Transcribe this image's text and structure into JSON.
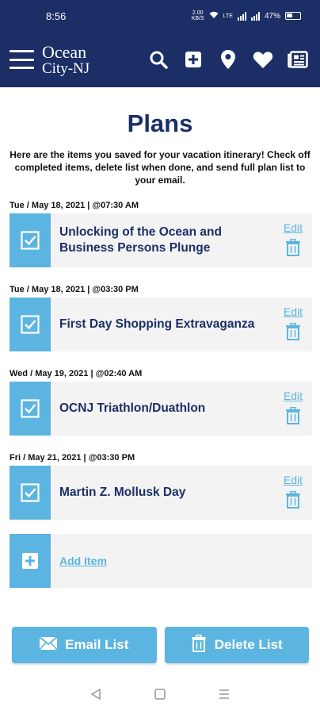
{
  "status_bar": {
    "time": "8:56",
    "network_speed": "2.00\nKB/S",
    "network_type": "LTE",
    "battery": "47%"
  },
  "header": {
    "logo_line1": "Ocean",
    "logo_line2": "City-NJ",
    "icons": [
      "search-icon",
      "add-icon",
      "location-pin-icon",
      "heart-icon",
      "newspaper-icon"
    ]
  },
  "page": {
    "title": "Plans",
    "intro": "Here are the items you saved for your vacation itinerary! Check off completed items, delete list when done, and send full plan list to your email."
  },
  "plans": [
    {
      "date": "Tue / May 18, 2021 | @07:30 AM",
      "title": "Unlocking of the Ocean and Business Persons Plunge",
      "edit": "Edit"
    },
    {
      "date": "Tue / May 18, 2021 | @03:30 PM",
      "title": "First Day Shopping Extravaganza",
      "edit": "Edit"
    },
    {
      "date": "Wed / May 19, 2021 | @02:40 AM",
      "title": "OCNJ Triathlon/Duathlon",
      "edit": "Edit"
    },
    {
      "date": "Fri / May 21, 2021 | @03:30 PM",
      "title": "Martin Z. Mollusk Day",
      "edit": "Edit"
    }
  ],
  "add_item": {
    "label": "Add Item"
  },
  "footer_buttons": {
    "email": "Email List",
    "delete": "Delete List"
  },
  "colors": {
    "navy": "#1b2f66",
    "accent": "#5cb5e0",
    "card_bg": "#f3f3f3"
  }
}
